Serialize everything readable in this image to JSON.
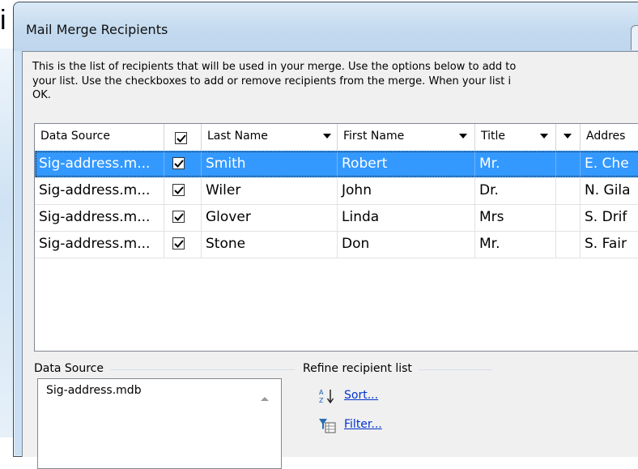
{
  "background": {
    "partial_text": "i"
  },
  "dialog": {
    "title": "Mail Merge Recipients",
    "instructions": [
      "This is the list of recipients that will be used in your merge.  Use the options below to add to",
      "your list.  Use the checkboxes to add or remove recipients from the merge.  When your list i",
      "OK."
    ]
  },
  "grid": {
    "columns": [
      "Data Source",
      "",
      "Last Name",
      "First Name",
      "Title",
      "",
      "Addres"
    ],
    "rows": [
      {
        "data_source": "Sig-address.m...",
        "checked": true,
        "last_name": "Smith",
        "first_name": "Robert",
        "title": "Mr.",
        "address": "E. Che",
        "selected": true
      },
      {
        "data_source": "Sig-address.m...",
        "checked": true,
        "last_name": "Wiler",
        "first_name": "John",
        "title": "Dr.",
        "address": "N. Gila",
        "selected": false
      },
      {
        "data_source": "Sig-address.m...",
        "checked": true,
        "last_name": "Glover",
        "first_name": "Linda",
        "title": "Mrs",
        "address": "S. Drif",
        "selected": false
      },
      {
        "data_source": "Sig-address.m...",
        "checked": true,
        "last_name": "Stone",
        "first_name": "Don",
        "title": "Mr.",
        "address": "S. Fair",
        "selected": false
      }
    ]
  },
  "data_source_section": {
    "label": "Data Source",
    "items": [
      "Sig-address.mdb"
    ]
  },
  "refine_section": {
    "label": "Refine recipient list",
    "links": [
      {
        "label": "Sort...",
        "icon": "sort-az-icon"
      },
      {
        "label": "Filter...",
        "icon": "filter-icon"
      }
    ]
  },
  "colors": {
    "selection": "#3399ff",
    "link": "#0033cc",
    "dialog_frame": "#c9dff2",
    "client_bg": "#f0f0f0"
  }
}
